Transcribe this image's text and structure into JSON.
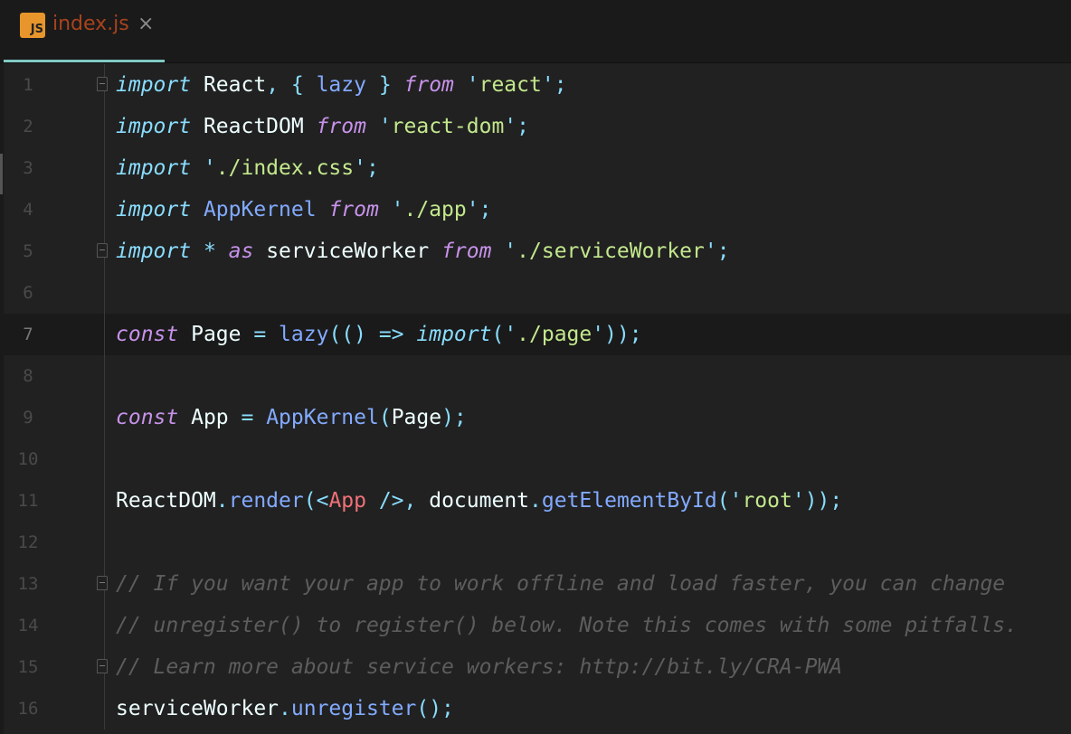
{
  "tab": {
    "icon_label": "JS",
    "filename": "index.js",
    "close": "×"
  },
  "current_line": 7,
  "lines": [
    {
      "n": "1",
      "fold": true,
      "tokens": [
        [
          "import",
          "kw"
        ],
        [
          " React",
          "id"
        ],
        [
          ", { ",
          "pn"
        ],
        [
          "lazy",
          "fn"
        ],
        [
          " } ",
          "pn"
        ],
        [
          "from",
          "kp"
        ],
        [
          " '",
          "pn"
        ],
        [
          "react",
          "str"
        ],
        [
          "';",
          "pn"
        ]
      ]
    },
    {
      "n": "2",
      "tokens": [
        [
          "import",
          "kw"
        ],
        [
          " ReactDOM ",
          "id"
        ],
        [
          "from",
          "kp"
        ],
        [
          " '",
          "pn"
        ],
        [
          "react-dom",
          "str"
        ],
        [
          "';",
          "pn"
        ]
      ]
    },
    {
      "n": "3",
      "tokens": [
        [
          "import",
          "kw"
        ],
        [
          " '",
          "pn"
        ],
        [
          "./index.css",
          "str"
        ],
        [
          "';",
          "pn"
        ]
      ]
    },
    {
      "n": "4",
      "tokens": [
        [
          "import",
          "kw"
        ],
        [
          " AppKernel ",
          "fn"
        ],
        [
          "from",
          "kp"
        ],
        [
          " '",
          "pn"
        ],
        [
          "./app",
          "str"
        ],
        [
          "';",
          "pn"
        ]
      ]
    },
    {
      "n": "5",
      "fold": true,
      "tokens": [
        [
          "import",
          "kw"
        ],
        [
          " * ",
          "kw"
        ],
        [
          "as",
          "kp"
        ],
        [
          " serviceWorker ",
          "id"
        ],
        [
          "from",
          "kp"
        ],
        [
          " '",
          "pn"
        ],
        [
          "./serviceWorker",
          "str"
        ],
        [
          "';",
          "pn"
        ]
      ]
    },
    {
      "n": "6",
      "tokens": []
    },
    {
      "n": "7",
      "tokens": [
        [
          "const",
          "kp"
        ],
        [
          " Page ",
          "id"
        ],
        [
          "= ",
          "pn"
        ],
        [
          "lazy",
          "fn"
        ],
        [
          "(() => ",
          "pn"
        ],
        [
          "import",
          "kw"
        ],
        [
          "('",
          "pn"
        ],
        [
          "./page",
          "str"
        ],
        [
          "'));",
          "pn"
        ]
      ]
    },
    {
      "n": "8",
      "tokens": []
    },
    {
      "n": "9",
      "tokens": [
        [
          "const",
          "kp"
        ],
        [
          " App ",
          "id"
        ],
        [
          "= ",
          "pn"
        ],
        [
          "AppKernel",
          "fn"
        ],
        [
          "(",
          "pn"
        ],
        [
          "Page",
          "id"
        ],
        [
          ");",
          "pn"
        ]
      ]
    },
    {
      "n": "10",
      "tokens": []
    },
    {
      "n": "11",
      "tokens": [
        [
          "ReactDOM",
          "id"
        ],
        [
          ".",
          "pn"
        ],
        [
          "render",
          "fn"
        ],
        [
          "(<",
          "pn"
        ],
        [
          "App",
          "tag"
        ],
        [
          " />, ",
          "pn"
        ],
        [
          "document",
          "id"
        ],
        [
          ".",
          "pn"
        ],
        [
          "getElementById",
          "fn"
        ],
        [
          "('",
          "pn"
        ],
        [
          "root",
          "str"
        ],
        [
          "'));",
          "pn"
        ]
      ]
    },
    {
      "n": "12",
      "tokens": []
    },
    {
      "n": "13",
      "fold": true,
      "tokens": [
        [
          "// If you want your app to work offline and load faster, you can change",
          "cm"
        ]
      ]
    },
    {
      "n": "14",
      "tokens": [
        [
          "// unregister() to register() below. Note this comes with some pitfalls.",
          "cm"
        ]
      ]
    },
    {
      "n": "15",
      "fold": true,
      "tokens": [
        [
          "// Learn more about service workers: http://bit.ly/CRA-PWA",
          "cm"
        ]
      ]
    },
    {
      "n": "16",
      "tokens": [
        [
          "serviceWorker",
          "id"
        ],
        [
          ".",
          "pn"
        ],
        [
          "unregister",
          "fn"
        ],
        [
          "();",
          "pn"
        ]
      ]
    }
  ]
}
